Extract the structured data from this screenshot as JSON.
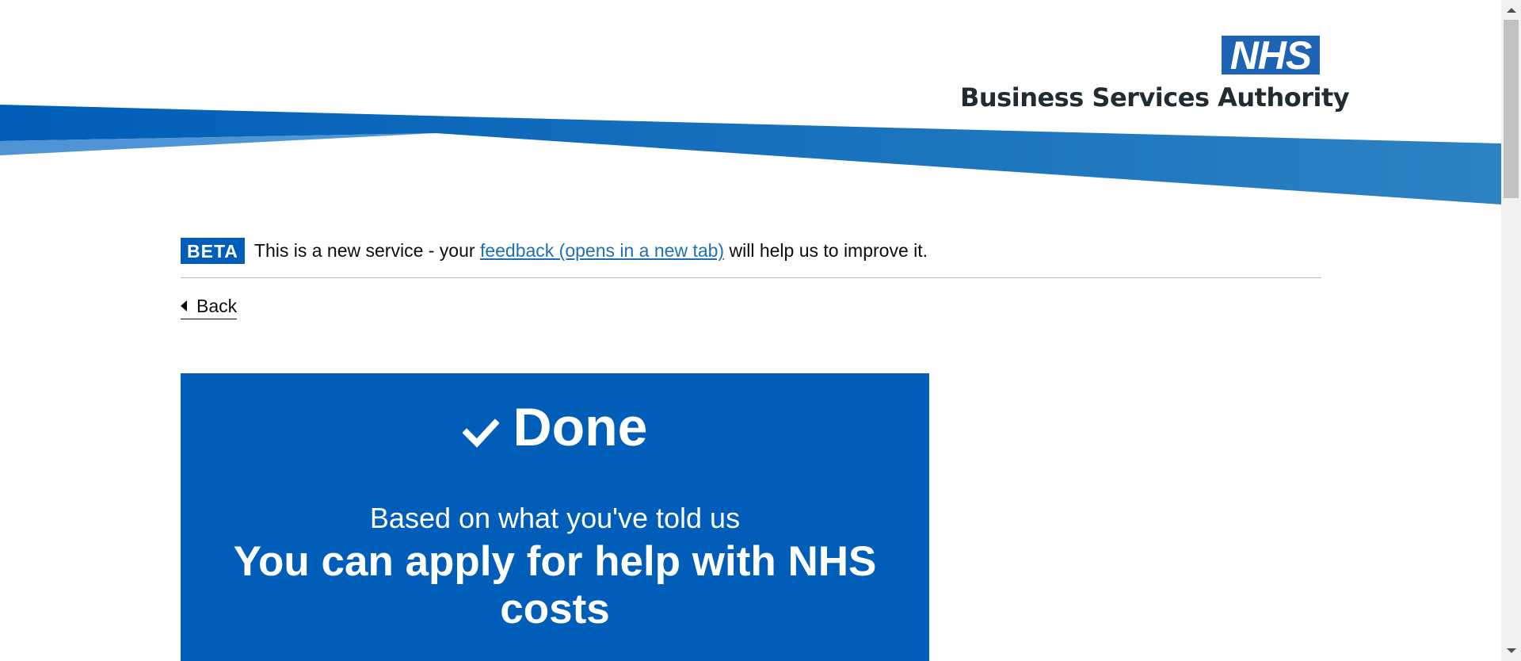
{
  "header": {
    "logo_text": "NHS",
    "org_name": "Business Services Authority",
    "brand_blue": "#005eb8",
    "logo_blue": "#1e64b4"
  },
  "phase_banner": {
    "tag": "BETA",
    "text_before": "This is a new service - your",
    "link_text": "feedback (opens in a new tab)",
    "text_after": "will help us to improve it."
  },
  "back_link": {
    "label": "Back",
    "icon": "chevron-left-icon"
  },
  "confirmation_panel": {
    "icon": "checkmark-icon",
    "title": "Done",
    "subtitle": "Based on what you've told us",
    "result": "You can apply for help with NHS costs"
  }
}
